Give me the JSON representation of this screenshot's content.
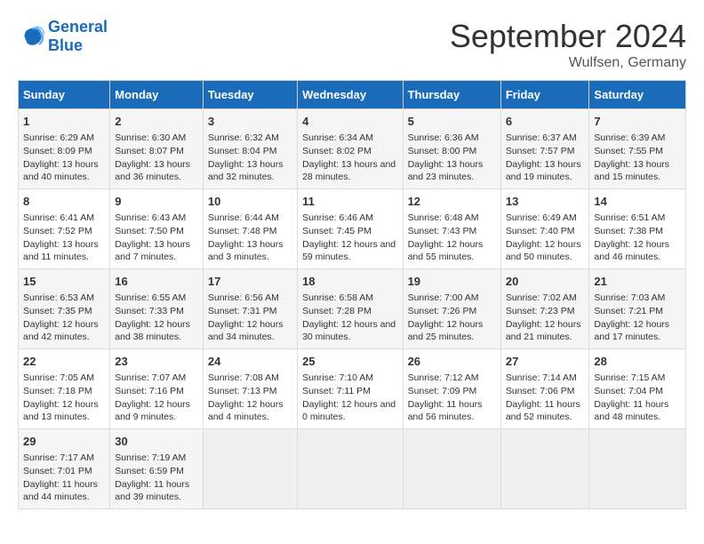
{
  "header": {
    "logo_line1": "General",
    "logo_line2": "Blue",
    "month_year": "September 2024",
    "location": "Wulfsen, Germany"
  },
  "days_of_week": [
    "Sunday",
    "Monday",
    "Tuesday",
    "Wednesday",
    "Thursday",
    "Friday",
    "Saturday"
  ],
  "weeks": [
    [
      {
        "day": "1",
        "sunrise": "Sunrise: 6:29 AM",
        "sunset": "Sunset: 8:09 PM",
        "daylight": "Daylight: 13 hours and 40 minutes."
      },
      {
        "day": "2",
        "sunrise": "Sunrise: 6:30 AM",
        "sunset": "Sunset: 8:07 PM",
        "daylight": "Daylight: 13 hours and 36 minutes."
      },
      {
        "day": "3",
        "sunrise": "Sunrise: 6:32 AM",
        "sunset": "Sunset: 8:04 PM",
        "daylight": "Daylight: 13 hours and 32 minutes."
      },
      {
        "day": "4",
        "sunrise": "Sunrise: 6:34 AM",
        "sunset": "Sunset: 8:02 PM",
        "daylight": "Daylight: 13 hours and 28 minutes."
      },
      {
        "day": "5",
        "sunrise": "Sunrise: 6:36 AM",
        "sunset": "Sunset: 8:00 PM",
        "daylight": "Daylight: 13 hours and 23 minutes."
      },
      {
        "day": "6",
        "sunrise": "Sunrise: 6:37 AM",
        "sunset": "Sunset: 7:57 PM",
        "daylight": "Daylight: 13 hours and 19 minutes."
      },
      {
        "day": "7",
        "sunrise": "Sunrise: 6:39 AM",
        "sunset": "Sunset: 7:55 PM",
        "daylight": "Daylight: 13 hours and 15 minutes."
      }
    ],
    [
      {
        "day": "8",
        "sunrise": "Sunrise: 6:41 AM",
        "sunset": "Sunset: 7:52 PM",
        "daylight": "Daylight: 13 hours and 11 minutes."
      },
      {
        "day": "9",
        "sunrise": "Sunrise: 6:43 AM",
        "sunset": "Sunset: 7:50 PM",
        "daylight": "Daylight: 13 hours and 7 minutes."
      },
      {
        "day": "10",
        "sunrise": "Sunrise: 6:44 AM",
        "sunset": "Sunset: 7:48 PM",
        "daylight": "Daylight: 13 hours and 3 minutes."
      },
      {
        "day": "11",
        "sunrise": "Sunrise: 6:46 AM",
        "sunset": "Sunset: 7:45 PM",
        "daylight": "Daylight: 12 hours and 59 minutes."
      },
      {
        "day": "12",
        "sunrise": "Sunrise: 6:48 AM",
        "sunset": "Sunset: 7:43 PM",
        "daylight": "Daylight: 12 hours and 55 minutes."
      },
      {
        "day": "13",
        "sunrise": "Sunrise: 6:49 AM",
        "sunset": "Sunset: 7:40 PM",
        "daylight": "Daylight: 12 hours and 50 minutes."
      },
      {
        "day": "14",
        "sunrise": "Sunrise: 6:51 AM",
        "sunset": "Sunset: 7:38 PM",
        "daylight": "Daylight: 12 hours and 46 minutes."
      }
    ],
    [
      {
        "day": "15",
        "sunrise": "Sunrise: 6:53 AM",
        "sunset": "Sunset: 7:35 PM",
        "daylight": "Daylight: 12 hours and 42 minutes."
      },
      {
        "day": "16",
        "sunrise": "Sunrise: 6:55 AM",
        "sunset": "Sunset: 7:33 PM",
        "daylight": "Daylight: 12 hours and 38 minutes."
      },
      {
        "day": "17",
        "sunrise": "Sunrise: 6:56 AM",
        "sunset": "Sunset: 7:31 PM",
        "daylight": "Daylight: 12 hours and 34 minutes."
      },
      {
        "day": "18",
        "sunrise": "Sunrise: 6:58 AM",
        "sunset": "Sunset: 7:28 PM",
        "daylight": "Daylight: 12 hours and 30 minutes."
      },
      {
        "day": "19",
        "sunrise": "Sunrise: 7:00 AM",
        "sunset": "Sunset: 7:26 PM",
        "daylight": "Daylight: 12 hours and 25 minutes."
      },
      {
        "day": "20",
        "sunrise": "Sunrise: 7:02 AM",
        "sunset": "Sunset: 7:23 PM",
        "daylight": "Daylight: 12 hours and 21 minutes."
      },
      {
        "day": "21",
        "sunrise": "Sunrise: 7:03 AM",
        "sunset": "Sunset: 7:21 PM",
        "daylight": "Daylight: 12 hours and 17 minutes."
      }
    ],
    [
      {
        "day": "22",
        "sunrise": "Sunrise: 7:05 AM",
        "sunset": "Sunset: 7:18 PM",
        "daylight": "Daylight: 12 hours and 13 minutes."
      },
      {
        "day": "23",
        "sunrise": "Sunrise: 7:07 AM",
        "sunset": "Sunset: 7:16 PM",
        "daylight": "Daylight: 12 hours and 9 minutes."
      },
      {
        "day": "24",
        "sunrise": "Sunrise: 7:08 AM",
        "sunset": "Sunset: 7:13 PM",
        "daylight": "Daylight: 12 hours and 4 minutes."
      },
      {
        "day": "25",
        "sunrise": "Sunrise: 7:10 AM",
        "sunset": "Sunset: 7:11 PM",
        "daylight": "Daylight: 12 hours and 0 minutes."
      },
      {
        "day": "26",
        "sunrise": "Sunrise: 7:12 AM",
        "sunset": "Sunset: 7:09 PM",
        "daylight": "Daylight: 11 hours and 56 minutes."
      },
      {
        "day": "27",
        "sunrise": "Sunrise: 7:14 AM",
        "sunset": "Sunset: 7:06 PM",
        "daylight": "Daylight: 11 hours and 52 minutes."
      },
      {
        "day": "28",
        "sunrise": "Sunrise: 7:15 AM",
        "sunset": "Sunset: 7:04 PM",
        "daylight": "Daylight: 11 hours and 48 minutes."
      }
    ],
    [
      {
        "day": "29",
        "sunrise": "Sunrise: 7:17 AM",
        "sunset": "Sunset: 7:01 PM",
        "daylight": "Daylight: 11 hours and 44 minutes."
      },
      {
        "day": "30",
        "sunrise": "Sunrise: 7:19 AM",
        "sunset": "Sunset: 6:59 PM",
        "daylight": "Daylight: 11 hours and 39 minutes."
      },
      null,
      null,
      null,
      null,
      null
    ]
  ]
}
